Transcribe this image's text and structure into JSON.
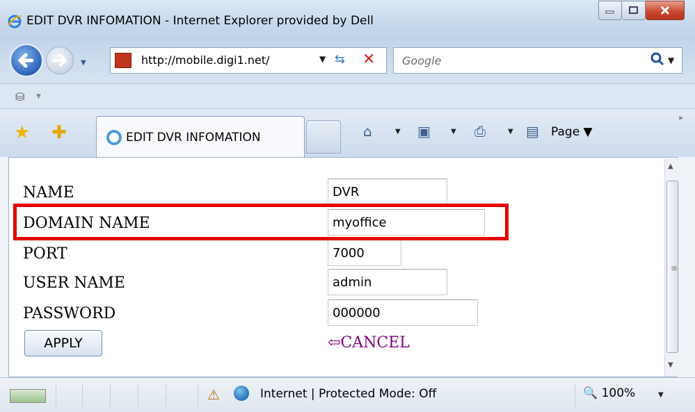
{
  "window": {
    "title": "EDIT DVR INFOMATION - Internet Explorer provided by Dell"
  },
  "navbar": {
    "address": "http://mobile.digi1.net/",
    "search_placeholder": "Google"
  },
  "tabs": [
    {
      "label": "EDIT DVR INFOMATION"
    }
  ],
  "commandbar": {
    "page_label": "Page",
    "overflow": "»"
  },
  "form": {
    "fields": [
      {
        "label": "NAME",
        "value": "DVR"
      },
      {
        "label": "DOMAIN NAME",
        "value": "myoffice"
      },
      {
        "label": "PORT",
        "value": "7000"
      },
      {
        "label": "USER NAME",
        "value": "admin"
      },
      {
        "label": "PASSWORD",
        "value": "000000"
      }
    ],
    "apply_label": "APPLY",
    "cancel_label": "CANCEL",
    "highlighted_field": "DOMAIN NAME",
    "highlight_color": "#e60000"
  },
  "statusbar": {
    "zone_text": "Internet | Protected Mode: Off",
    "zoom": "100%"
  }
}
